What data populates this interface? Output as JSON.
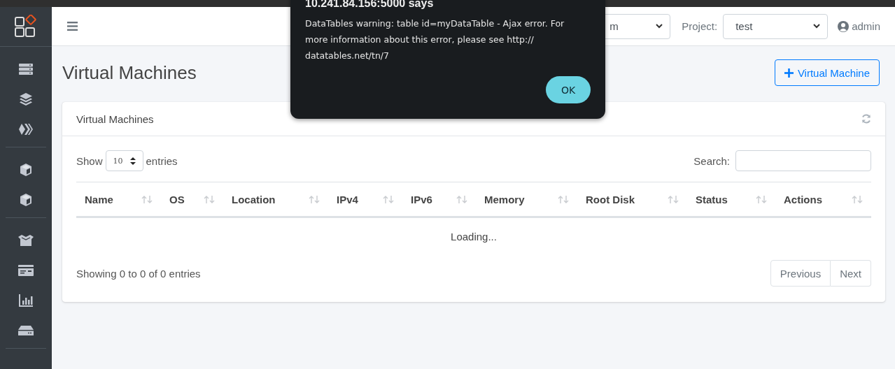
{
  "header": {
    "filters": [
      {
        "value": "m"
      },
      {
        "label": "Project:",
        "value": "test"
      }
    ],
    "user": "admin"
  },
  "page": {
    "title": "Virtual Machines",
    "add_button": "Virtual Machine"
  },
  "card": {
    "title": "Virtual Machines",
    "length": {
      "before": "Show",
      "value": "10",
      "after": "entries"
    },
    "search": {
      "label": "Search:"
    },
    "columns": [
      "Name",
      "OS",
      "Location",
      "IPv4",
      "IPv6",
      "Memory",
      "Root Disk",
      "Status",
      "Actions"
    ],
    "empty_message": "Loading...",
    "info": "Showing 0 to 0 of 0 entries",
    "pagination": [
      "Previous",
      "Next"
    ]
  },
  "dialog": {
    "title": "10.241.84.156:5000 says",
    "message": "DataTables warning: table id=myDataTable - Ajax error. For more information about this error, please see http:// datatables.net/tn/7",
    "button": "OK"
  }
}
